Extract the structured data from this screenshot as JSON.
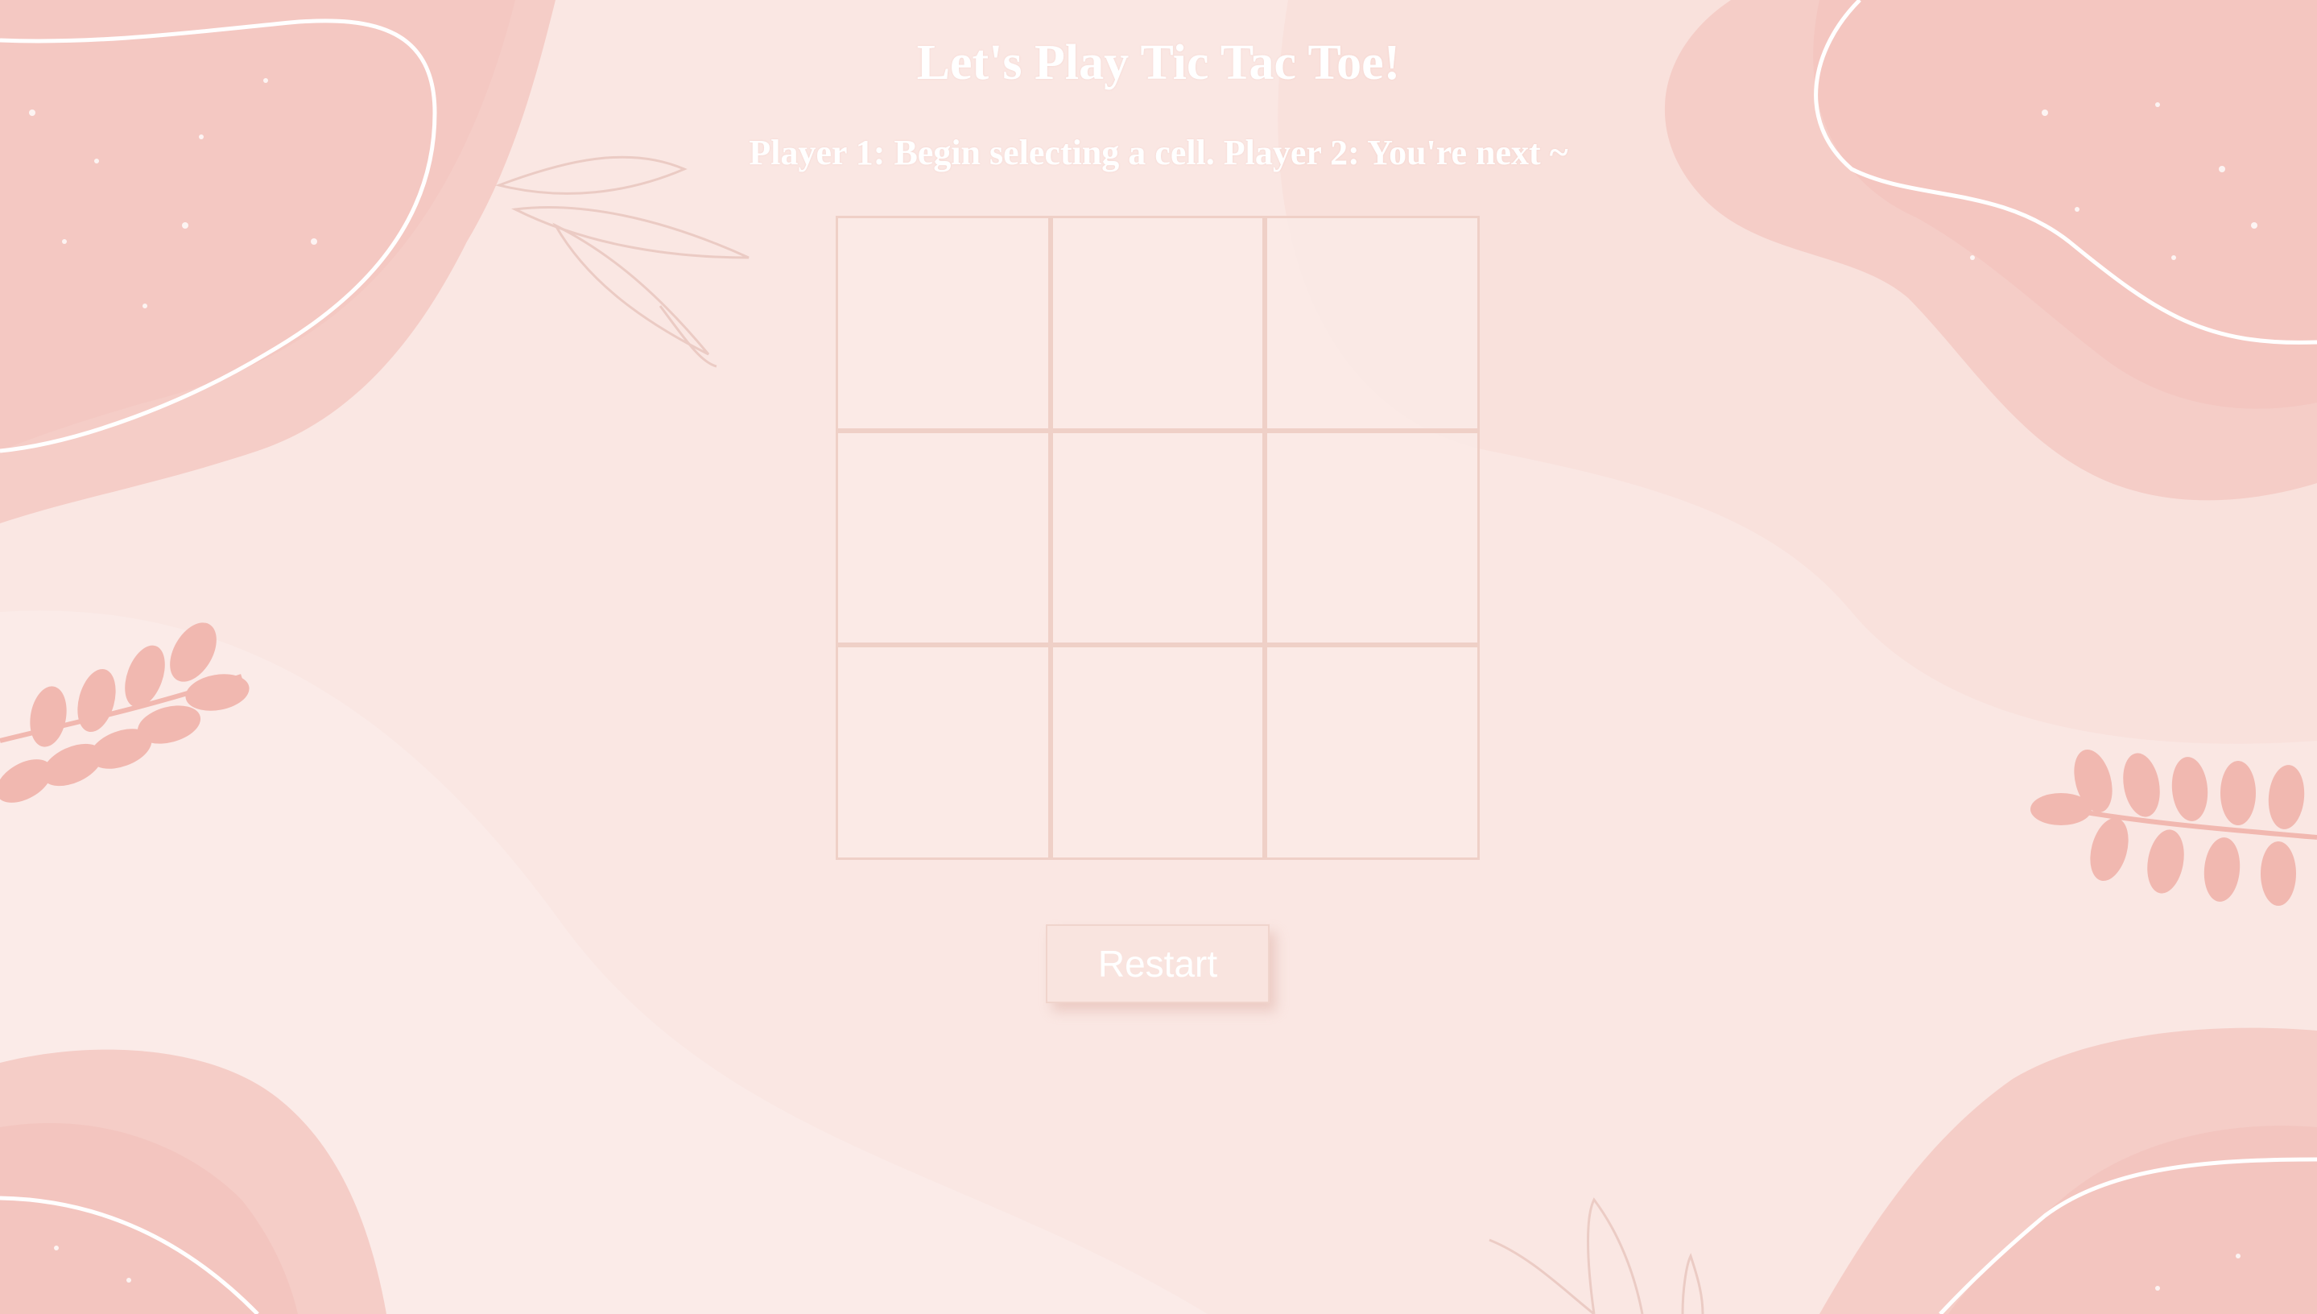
{
  "header": {
    "title": "Let's Play Tic Tac Toe!",
    "status": "Player 1: Begin selecting a cell. Player 2: You're next ~"
  },
  "board": {
    "cells": [
      "",
      "",
      "",
      "",
      "",
      "",
      "",
      "",
      ""
    ]
  },
  "controls": {
    "restart_label": "Restart"
  },
  "theme": {
    "background": "#fae7e3",
    "blob_color": "#f5cdc7",
    "leaf_color": "#f1b8b0",
    "grid_line": "#efd0c7",
    "text_color": "#ffffff"
  }
}
